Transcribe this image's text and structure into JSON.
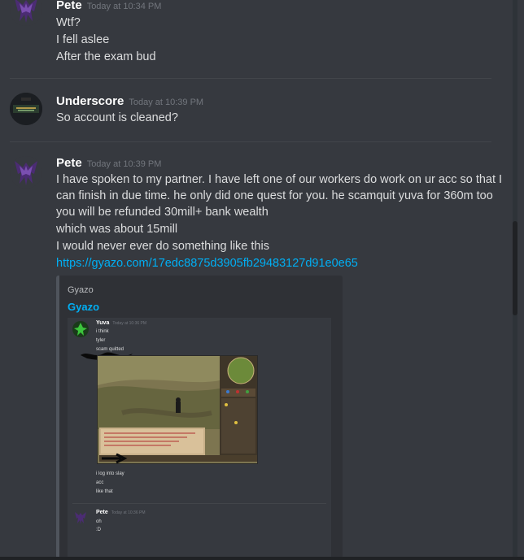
{
  "messages": [
    {
      "author": "Pete",
      "timestamp": "Today at 10:34 PM",
      "lines": [
        "Wtf?",
        "I fell aslee",
        "After the exam bud"
      ]
    },
    {
      "author": "Underscore",
      "timestamp": "Today at 10:39 PM",
      "lines": [
        "So account is cleaned?"
      ]
    },
    {
      "author": "Pete",
      "timestamp": "Today at 10:39 PM",
      "lines": [
        "I have spoken to my partner. I have left one of our workers do work on ur acc so that I",
        "can finish in due time. he only did one quest for you. he scamquit yuva for 360m too",
        "you will be refunded 30mill+ bank wealth",
        "which was about 15mill",
        "I would never ever do something like this"
      ],
      "link": "https://gyazo.com/17edc8875d3905fb29483127d91e0e65"
    }
  ],
  "embed": {
    "provider": "Gyazo",
    "title": "Gyazo",
    "screenshot": {
      "msg1": {
        "author": "Yuva",
        "timestamp": "Today at 10:36 PM",
        "lines": [
          "i think",
          "tyler",
          "scam quitted"
        ],
        "after_lines": [
          "i log into slay",
          "acc",
          "like that"
        ]
      },
      "msg2": {
        "author": "Pete",
        "timestamp": "Today at 10:36 PM",
        "lines": [
          "oh",
          ":D"
        ]
      }
    }
  },
  "colors": {
    "background": "#36393f",
    "link": "#00aff4",
    "author": "#ffffff",
    "text": "#dcddde",
    "timestamp": "#72767d"
  }
}
